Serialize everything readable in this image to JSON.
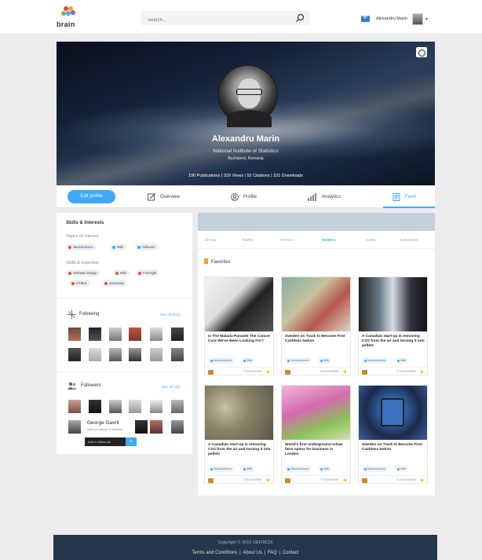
{
  "header": {
    "logo_text": "brain",
    "search_placeholder": "Search...",
    "user_name": "Alexandru Marin"
  },
  "profile": {
    "name": "Alexandru Marin",
    "institution": "National Institute of Statistics",
    "location": "Bucharest, Romania",
    "stats": "190 Publications | 329 Views | 52 Citations | 231 Downloads"
  },
  "tabs": {
    "edit_label": "Edit profile",
    "items": [
      {
        "label": "Overview",
        "icon": "edit-icon"
      },
      {
        "label": "Profile",
        "icon": "user-icon"
      },
      {
        "label": "Analytics",
        "icon": "bar-chart-icon"
      },
      {
        "label": "Feed",
        "icon": "document-icon"
      }
    ],
    "active": "Feed"
  },
  "skills": {
    "title": "Skills & Interests",
    "topics_label": "Topics of interest",
    "topics": [
      "Neuroscience",
      "Wiki",
      "Software"
    ],
    "expertise_label": "Skills & expertise",
    "expertise": [
      "Software Design",
      "Wiki",
      "Foresight",
      "HTML5",
      "Javascript"
    ]
  },
  "following": {
    "title": "Following",
    "see_all": "See All (213)"
  },
  "followers": {
    "title": "Followers",
    "see_all": "See All (15)",
    "hover_name": "George Gavril",
    "hover_inst": "National Institute of Statistics",
    "tooltip": "Add to follow list",
    "tooltip_icon": "+"
  },
  "feed": {
    "filters": [
      "All Feed",
      "PEERS",
      "ORTECH",
      "NODES",
      "EXIRS",
      "EURAXESS"
    ],
    "selected_filter": "NODES",
    "favorites_label": "Favorites",
    "cards": [
      {
        "title": "Is The Malaria Parasite The Cancer Cure We've Been Looking For?",
        "tags": [
          "Neuroscience",
          "Wiki"
        ],
        "date": "7 November"
      },
      {
        "title": "Sweden on Track to Become First Cashless Nation",
        "tags": [
          "Neuroscience",
          "Wiki"
        ],
        "date": "6 November"
      },
      {
        "title": "A Canadian start-up is removing CO2 from the air and turning it into pellets",
        "tags": [
          "Neuroscience",
          "Wiki"
        ],
        "date": "7 November"
      },
      {
        "title": "A Canadian start-up is removing CO2 from the air and turning it into pellets",
        "tags": [
          "Neuroscience",
          "Wiki"
        ],
        "date": "7 November"
      },
      {
        "title": "World's first underground urban farm opens for business in London",
        "tags": [
          "Neuroscience",
          "Wiki"
        ],
        "date": "7 November"
      },
      {
        "title": "Sweden on Track to Become First Cashless Nation",
        "tags": [
          "Neuroscience",
          "Wiki"
        ],
        "date": "6 November"
      }
    ]
  },
  "footer": {
    "copyright": "Copyright © 2015 UEFISCDI",
    "links": [
      "Terms and Conditions",
      "About Us",
      "FAQ",
      "Contact"
    ]
  }
}
